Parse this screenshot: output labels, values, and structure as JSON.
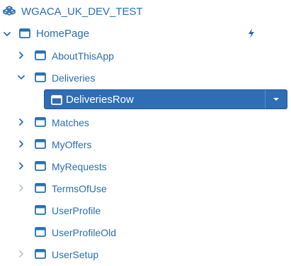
{
  "tree": {
    "root": {
      "label": "WGACA_UK_DEV_TEST",
      "icon": "stack-icon"
    },
    "homepage": {
      "label": "HomePage",
      "icon": "window-icon",
      "action_icon": "lightning-bolt-icon"
    },
    "children": [
      {
        "label": "AboutThisApp",
        "expandable": true,
        "expanded": false,
        "icon": "window-icon"
      },
      {
        "label": "Deliveries",
        "expandable": true,
        "expanded": true,
        "icon": "window-icon"
      },
      {
        "label": "Matches",
        "expandable": true,
        "expanded": false,
        "icon": "window-icon"
      },
      {
        "label": "MyOffers",
        "expandable": true,
        "expanded": false,
        "icon": "window-icon"
      },
      {
        "label": "MyRequests",
        "expandable": true,
        "expanded": false,
        "icon": "window-icon"
      },
      {
        "label": "TermsOfUse",
        "expandable": true,
        "expanded": false,
        "icon": "window-icon"
      },
      {
        "label": "UserProfile",
        "expandable": false,
        "icon": "window-icon"
      },
      {
        "label": "UserProfileOld",
        "expandable": false,
        "icon": "window-icon"
      },
      {
        "label": "UserSetup",
        "expandable": true,
        "expanded": false,
        "icon": "window-icon"
      }
    ],
    "selected": {
      "label": "DeliveriesRow",
      "icon": "window-icon",
      "dropdown_icon": "caret-down-icon"
    }
  },
  "colors": {
    "accent": "#2a6fb0",
    "selected_bg": "#2f6db5",
    "muted_chevron": "#b9c3cc"
  }
}
